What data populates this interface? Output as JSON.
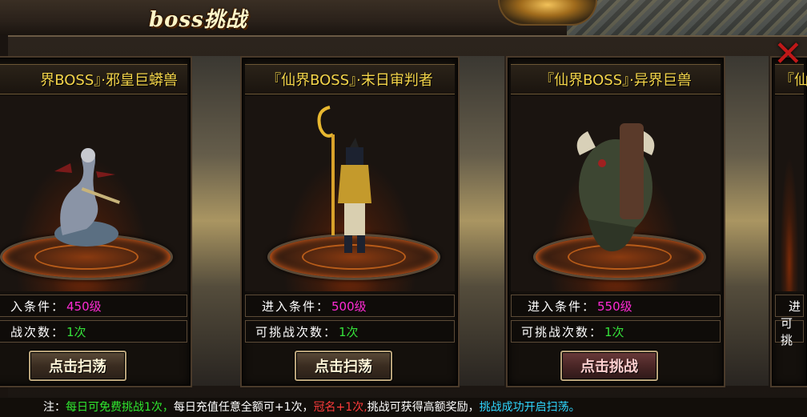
{
  "header": {
    "title": "boss挑战"
  },
  "cards": [
    {
      "name": "界BOSS』·邪皇巨蟒兽",
      "enter_label": "入条件：",
      "enter_value": "450级",
      "times_label": "战次数：",
      "times_value": "1次",
      "button": "点击扫荡"
    },
    {
      "name": "『仙界BOSS』·末日审判者",
      "enter_label": "进入条件：",
      "enter_value": "500级",
      "times_label": "可挑战次数：",
      "times_value": "1次",
      "button": "点击扫荡"
    },
    {
      "name": "『仙界BOSS』·异界巨兽",
      "enter_label": "进入条件：",
      "enter_value": "550级",
      "times_label": "可挑战次数：",
      "times_value": "1次",
      "button": "点击挑战"
    },
    {
      "name": "『仙",
      "enter_label": "进",
      "times_label": "可挑"
    }
  ],
  "footer": {
    "prefix": "注：",
    "part1": "每日可免费挑战1次，",
    "part2": "每日充值任意全额可+1次，",
    "part3": "冠名+1次,",
    "part4": "挑战可获得高额奖励，",
    "part5": "挑战成功开启扫荡。"
  },
  "icons": {
    "close": "close-x-icon",
    "emblem": "emblem-icon"
  }
}
